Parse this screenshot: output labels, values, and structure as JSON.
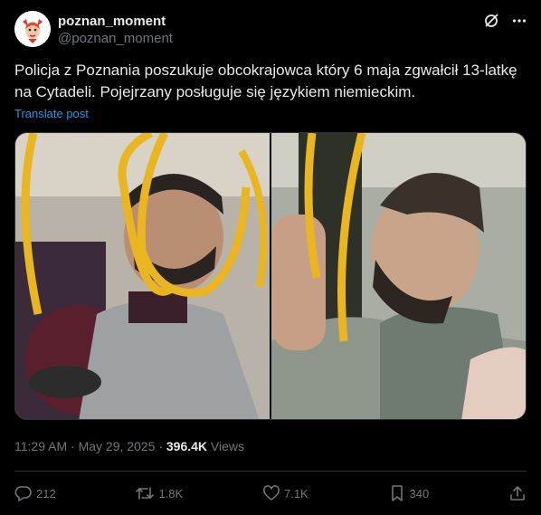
{
  "author": {
    "display_name": "poznan_moment",
    "handle": "@poznan_moment"
  },
  "tweet": {
    "text": "Policja z Poznania poszukuje obcokrajowca który 6 maja zgwałcił 13-latkę na Cytadeli. Pojejrzany posługuje się językiem niemieckim.",
    "translate_label": "Translate post"
  },
  "media": {
    "images": [
      "suspect-photo-front",
      "suspect-photo-side"
    ]
  },
  "meta": {
    "time": "11:29 AM",
    "separator": "·",
    "date": "May 29, 2025",
    "views_count": "396.4K",
    "views_label": "Views"
  },
  "actions": {
    "replies": "212",
    "reposts": "1.8K",
    "likes": "7.1K",
    "bookmarks": "340"
  },
  "icons": {
    "header": [
      "grok-icon",
      "more-icon"
    ],
    "actions": [
      "reply-icon",
      "repost-icon",
      "like-icon",
      "bookmark-icon",
      "share-icon"
    ]
  },
  "colors": {
    "background": "#000000",
    "text": "#e7e9ea",
    "secondary": "#71767b",
    "link": "#1d9bf0",
    "border": "#2f3336"
  }
}
